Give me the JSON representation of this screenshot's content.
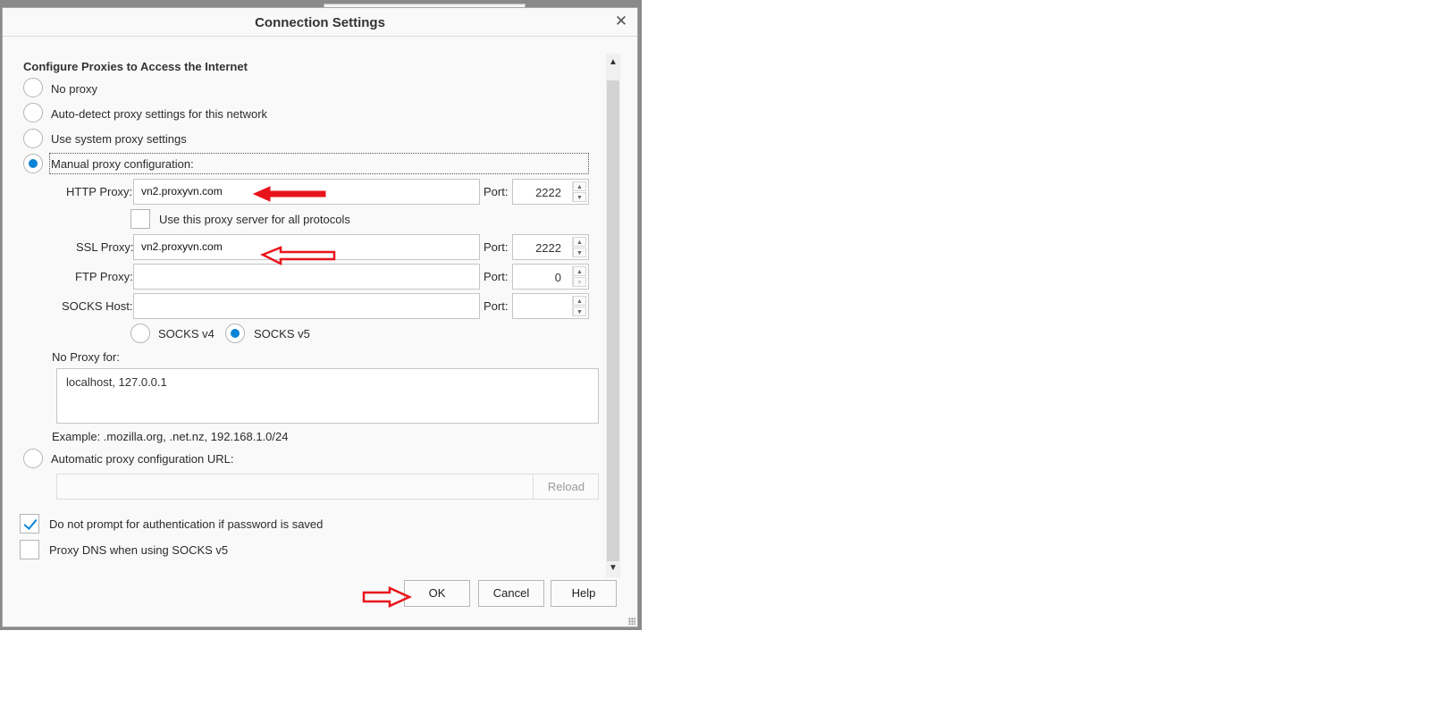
{
  "dialog": {
    "title": "Connection Settings",
    "close_label": "✕"
  },
  "section_heading": "Configure Proxies to Access the Internet",
  "proxy_modes": [
    {
      "label": "No proxy",
      "checked": false
    },
    {
      "label": "Auto-detect proxy settings for this network",
      "checked": false
    },
    {
      "label": "Use system proxy settings",
      "checked": false
    },
    {
      "label": "Manual proxy configuration:",
      "checked": true
    }
  ],
  "manual": {
    "http": {
      "label": "HTTP Proxy:",
      "value": "vn2.proxyvn.com",
      "port_label": "Port:",
      "port": "2222"
    },
    "use_for_all": {
      "label": "Use this proxy server for all protocols",
      "checked": false
    },
    "ssl": {
      "label": "SSL Proxy:",
      "value": "vn2.proxyvn.com",
      "port_label": "Port:",
      "port": "2222"
    },
    "ftp": {
      "label": "FTP Proxy:",
      "value": "",
      "port_label": "Port:",
      "port": "0"
    },
    "socks": {
      "label": "SOCKS Host:",
      "value": "",
      "port_label": "Port:",
      "port": ""
    },
    "socks_v4": {
      "label": "SOCKS v4",
      "checked": false
    },
    "socks_v5": {
      "label": "SOCKS v5",
      "checked": true
    }
  },
  "no_proxy": {
    "label": "No Proxy for:",
    "value": "localhost, 127.0.0.1",
    "example": "Example: .mozilla.org, .net.nz, 192.168.1.0/24"
  },
  "auto_url": {
    "label": "Automatic proxy configuration URL:",
    "checked": false,
    "value": "",
    "reload_label": "Reload"
  },
  "options": {
    "no_prompt_auth": {
      "label": "Do not prompt for authentication if password is saved",
      "checked": true
    },
    "proxy_dns": {
      "label": "Proxy DNS when using SOCKS v5",
      "checked": false
    }
  },
  "buttons": {
    "ok": "OK",
    "cancel": "Cancel",
    "help": "Help"
  },
  "scrollbar": {
    "up": "▲",
    "down": "▼"
  },
  "colors": {
    "accent": "#0a84d6",
    "annotation_arrow": "#e8141c"
  }
}
